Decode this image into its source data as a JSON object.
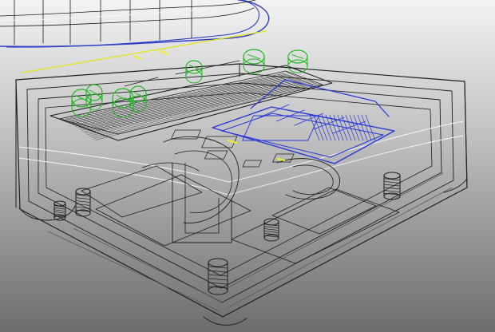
{
  "viewport": {
    "mode": "wireframe-3d-cad",
    "colors": {
      "background_top": "#f3f3f3",
      "background_mid": "#bfbfbf",
      "background_bottom": "#6d6d6d",
      "wire_dark": "#1f1f1f",
      "wire_light": "#f6f6f6",
      "wire_gray": "#5a5a5a",
      "lid_blue": "#2e3fc4",
      "board_blue": "#2838d6",
      "component_green": "#1fb51f",
      "highlight_yellow": "#e3e21c",
      "accent_yellow": "#f2ef20"
    }
  },
  "scene": {
    "icon_names": [
      "lid-cylinder-icon",
      "breadboard-icon",
      "circuit-board-icon",
      "green-component-icon",
      "standoff-screw-icon",
      "enclosure-base-icon"
    ]
  }
}
